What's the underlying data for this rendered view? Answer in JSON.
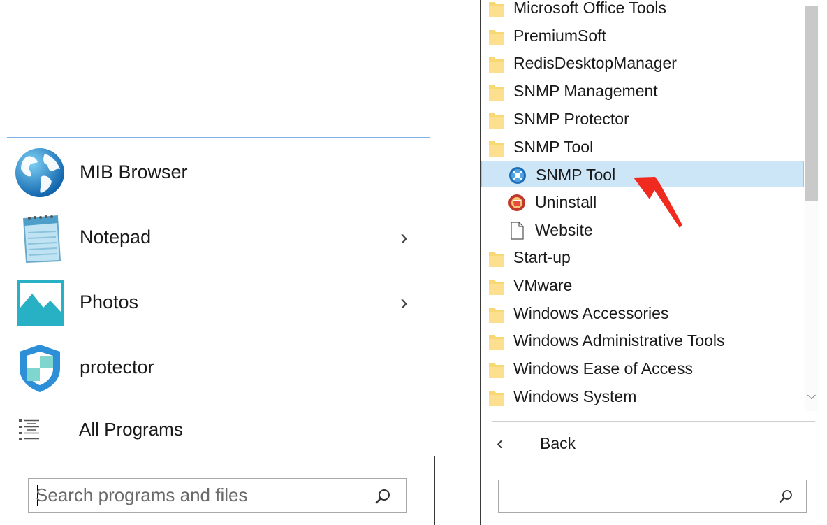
{
  "left_menu": {
    "pinned": [
      {
        "label": "MIB Browser",
        "icon": "globe-icon",
        "has_submenu": false
      },
      {
        "label": "Notepad",
        "icon": "notepad-icon",
        "has_submenu": true
      },
      {
        "label": "Photos",
        "icon": "photos-icon",
        "has_submenu": true
      },
      {
        "label": "protector",
        "icon": "shield-icon",
        "has_submenu": false
      }
    ],
    "all_programs_label": "All Programs",
    "search_placeholder": "Search programs and files"
  },
  "programs_list": {
    "items": [
      {
        "label": "Microsoft Office Tools",
        "type": "folder"
      },
      {
        "label": "PremiumSoft",
        "type": "folder"
      },
      {
        "label": "RedisDesktopManager",
        "type": "folder"
      },
      {
        "label": "SNMP Management",
        "type": "folder"
      },
      {
        "label": "SNMP Protector",
        "type": "folder"
      },
      {
        "label": "SNMP Tool",
        "type": "folder"
      },
      {
        "label": "SNMP Tool",
        "type": "app",
        "selected": true,
        "icon": "snmp-tool-icon"
      },
      {
        "label": "Uninstall",
        "type": "app",
        "icon": "uninstall-icon"
      },
      {
        "label": "Website",
        "type": "app",
        "icon": "document-icon"
      },
      {
        "label": "Start-up",
        "type": "folder"
      },
      {
        "label": "VMware",
        "type": "folder"
      },
      {
        "label": "Windows Accessories",
        "type": "folder"
      },
      {
        "label": "Windows Administrative Tools",
        "type": "folder"
      },
      {
        "label": "Windows Ease of Access",
        "type": "folder"
      },
      {
        "label": "Windows System",
        "type": "folder"
      }
    ],
    "back_label": "Back",
    "search_value": ""
  },
  "colors": {
    "selection_bg": "#cde6f7",
    "selection_border": "#9bc8ea",
    "folder": "#f8d775",
    "annotation_arrow": "#f02a1e"
  }
}
